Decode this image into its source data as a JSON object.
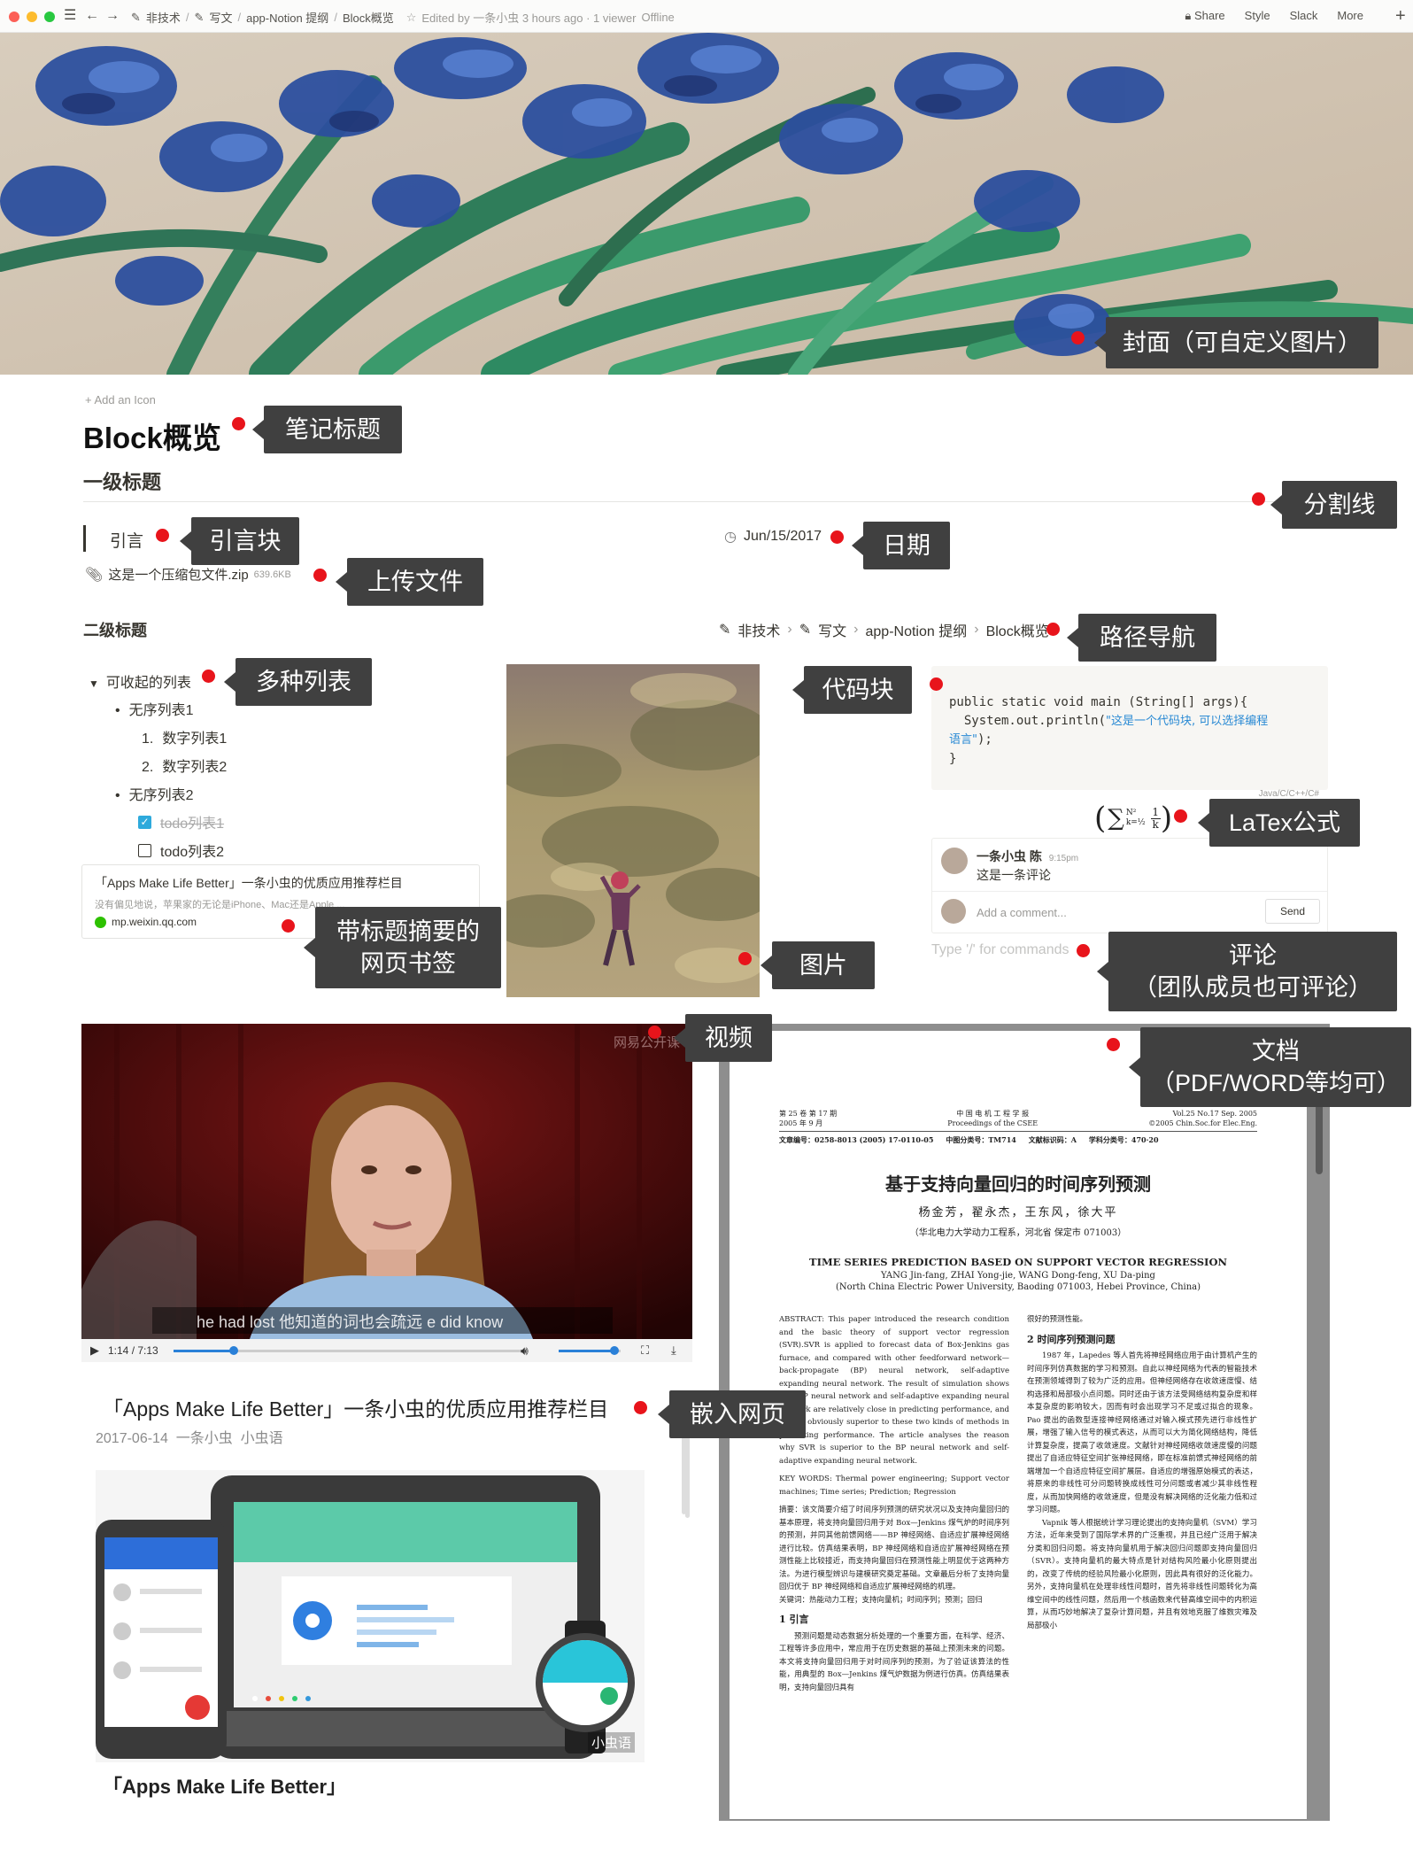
{
  "topbar": {
    "crumbs": [
      "非技术",
      "写文",
      "app-Notion 提纲",
      "Block概览"
    ],
    "edited": "Edited by 一条小虫 3 hours ago · 1 viewer",
    "status": "Offline",
    "actions": [
      "Share",
      "Style",
      "Slack",
      "More"
    ]
  },
  "page": {
    "add_icon": "+ Add an Icon",
    "title": "Block概览",
    "heading1": "一级标题",
    "quote": "引言",
    "date": "Jun/15/2017",
    "file_name": "这是一个压缩包文件.zip",
    "file_size": "639.6KB",
    "heading2": "二级标题",
    "breadcrumb": [
      "非技术",
      "写文",
      "app-Notion 提纲",
      "Block概览"
    ],
    "list": {
      "toggle": "可收起的列表",
      "bullet1": "无序列表1",
      "num1": "数字列表1",
      "num2": "数字列表2",
      "num1_marker": "1.",
      "num2_marker": "2.",
      "bullet2": "无序列表2",
      "todo1": "todo列表1",
      "todo2": "todo列表2"
    },
    "bookmark": {
      "title": "「Apps Make Life Better」一条小虫的优质应用推荐栏目",
      "desc": "没有偏见地说，苹果家的无论是iPhone、Mac还是Apple ...",
      "url": "mp.weixin.qq.com"
    },
    "code": {
      "line1": "public static void main (String[] args){",
      "line2a": "  System.out.println(",
      "line2b": "\"这是一个代码块, 可以选择编程",
      "line3a": "语言\"",
      "line3b": ");",
      "line4": "}",
      "language": "Java/C/C++/C#"
    },
    "latex": "(∑_{k=1/2}^{N²} 1/k)",
    "comment": {
      "author": "一条小虫 陈",
      "time": "9:15pm",
      "text": "这是一条评论",
      "placeholder": "Add a comment...",
      "send": "Send"
    },
    "command_placeholder": "Type '/' for commands",
    "video": {
      "time": "1:14 / 7:13",
      "watermark": "网易公开课",
      "subtitle_cn": "他知道的词也会疏远",
      "subtitle_en": "he had lost",
      "subtitle_en2": "e did know",
      "progress": 0.17,
      "volume": 0.9
    },
    "embed": {
      "title": "「Apps Make Life Better」一条小虫的优质应用推荐栏目",
      "meta": "2017-06-14  一条小虫  小虫语",
      "footer_title": "「Apps Make Life Better」",
      "watermark": "小虫语"
    },
    "pdf": {
      "header_left1": "第 25 卷 第 17 期",
      "header_left2": "2005 年 9 月",
      "header_mid1": "中 国 电 机 工 程 学 报",
      "header_mid2": "Proceedings of the CSEE",
      "header_right1": "Vol.25 No.17 Sep. 2005",
      "header_right2": "©2005 Chin.Soc.for Elec.Eng.",
      "meta": "文章编号：0258-8013 (2005) 17-0110-05     中图分类号：TM714     文献标识码：A     学科分类号：470·20",
      "title_cn": "基于支持向量回归的时间序列预测",
      "authors_cn": "杨金芳，翟永杰，王东风，徐大平",
      "affil_cn": "（华北电力大学动力工程系，河北省 保定市 071003）",
      "title_en": "TIME SERIES PREDICTION BASED ON SUPPORT VECTOR REGRESSION",
      "authors_en": "YANG Jin-fang, ZHAI Yong-jie, WANG Dong-feng, XU Da-ping",
      "affil_en": "(North China Electric Power University, Baoding 071003, Hebei Province, China)",
      "abstract": "ABSTRACT: This paper introduced the research condition and the basic theory of support vector regression (SVR).SVR is applied to forecast data of Box-Jenkins gas furnace, and compared with other feedforward network—back-propagate (BP) neural network, self-adaptive expanding neural network. The result of simulation shows that BP neural network and self-adaptive expanding neural network are relatively close in predicting performance, and SVR is obviously superior to these two kinds of methods in predicting performance. The article analyses the reason why SVR is superior to the BP neural network and self-adaptive expanding neural network.",
      "keywords": "KEY WORDS: Thermal power engineering; Support vector machines; Time series; Prediction; Regression",
      "abstract_cn": "摘要：该文简要介绍了时间序列预测的研究状况以及支持向量回归的基本原理，将支持向量回归用于对 Box—Jenkins 煤气炉的时间序列的预测，并同其他前馈网络——BP 神经网络、自适应扩展神经网络进行比较。仿真结果表明，BP 神经网络和自适应扩展神经网络在预测性能上比较接近，而支持向量回归在预测性能上明显优于这两种方法。为进行模型辨识与建模研究奠定基础。文章最后分析了支持向量回归优于 BP 神经网络和自适应扩展神经网络的机理。",
      "keywords_cn": "关键词：热能动力工程；支持向量机；时间序列；预测；回归",
      "sec1": "1  引言",
      "sec1_text": "预测问题是动态数据分析处理的一个重要方面，在科学、经济、工程等许多应用中，常应用于在历史数据的基础上预测未来的问题。本文将支持向量回归用于对时间序列的预测，为了验证该算法的性能，用典型的 Box—Jenkins 煤气炉数据为例进行仿真。仿真结果表明，支持向量回归具有",
      "right_top": "很好的预测性能。",
      "sec2": "2  时间序列预测问题",
      "right_text": "1987 年，Lapedes 等人首先将神经网络应用于由计算机产生的时间序列仿真数据的学习和预测。自此以神经网络为代表的智能技术在预测领域得到了较为广泛的应用。但神经网络存在收敛速度慢、结构选择和局部极小点问题。同时还由于该方法受网络结构复杂度和样本复杂度的影响较大，因而有时会出现学习不足或过拟合的现象。Pao 提出的函数型连接神经网络通过对输入模式预先进行非线性扩展，增强了输入信号的模式表达，从而可以大为简化网络结构，降低计算复杂度，提高了收敛速度。文献针对神经网络收敛速度慢的问题提出了自适应特征空间扩张神经网络，即在标准前馈式神经网络的前端增加一个自适应特征空间扩展层。自适应的增强原始模式的表达，将原来的非线性可分问题转换成线性可分问题或者减少其非线性程度，从而加快网络的收敛速度，但是没有解决网络的泛化能力低和过学习问题。",
      "right_text2": "Vapnik 等人根据统计学习理论提出的支持向量机（SVM）学习方法，近年来受到了国际学术界的广泛重视，并且已经广泛用于解决分类和回归问题。将支持向量机用于解决回归问题即支持向量回归（SVR）。支持向量机的最大特点是针对结构风险最小化原则提出的，改变了传统的经验风险最小化原则，因此具有很好的泛化能力。另外，支持向量机在处理非线性问题时，首先将非线性问题转化为高维空间中的线性问题，然后用一个核函数来代替高维空间中的内积运算，从而巧妙地解决了复杂计算问题，并且有效地克服了维数灾难及局部极小"
    }
  },
  "callouts": {
    "cover": "封面（可自定义图片）",
    "title": "笔记标题",
    "divider": "分割线",
    "quote": "引言块",
    "date": "日期",
    "file": "上传文件",
    "breadcrumb": "路径导航",
    "lists": "多种列表",
    "code": "代码块",
    "latex": "LaTex公式",
    "bookmark1": "带标题摘要的",
    "bookmark2": "网页书签",
    "image": "图片",
    "comment1": "评论",
    "comment2": "（团队成员也可评论）",
    "video": "视频",
    "doc1": "文档",
    "doc2": "（PDF/WORD等均可）",
    "embed": "嵌入网页"
  },
  "colors": {
    "callout_bg": "#404040",
    "dot": "#e8141b",
    "accent": "#2383e2"
  }
}
